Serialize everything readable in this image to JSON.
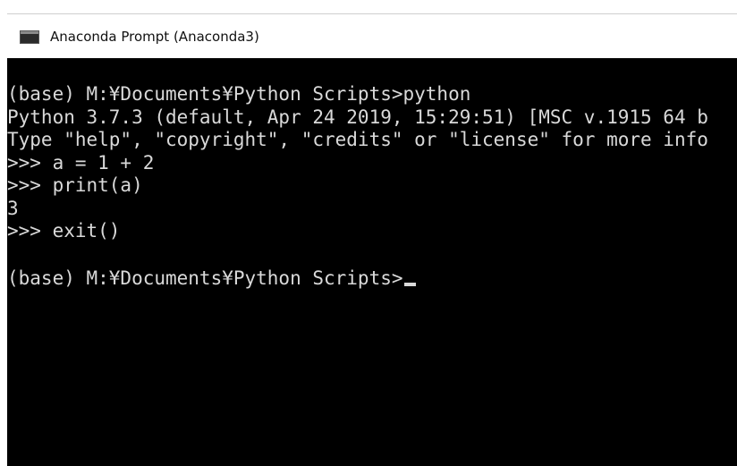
{
  "window": {
    "title": "Anaconda Prompt (Anaconda3)",
    "icon": "console-icon"
  },
  "console": {
    "lines": [
      "(base) M:¥Documents¥Python Scripts>python",
      "Python 3.7.3 (default, Apr 24 2019, 15:29:51) [MSC v.1915 64 b",
      "Type \"help\", \"copyright\", \"credits\" or \"license\" for more info",
      ">>> a = 1 + 2",
      ">>> print(a)",
      "3",
      ">>> exit()",
      "",
      "(base) M:¥Documents¥Python Scripts>"
    ],
    "cursor": "block-underline"
  },
  "colors": {
    "console_background": "#000000",
    "console_text": "#d9d9d9",
    "titlebar_background": "#ffffff"
  }
}
